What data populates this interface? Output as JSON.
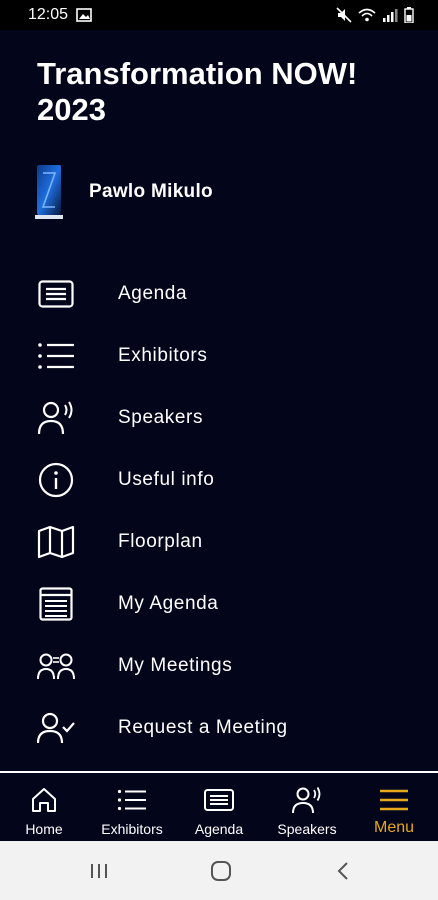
{
  "status": {
    "time": "12:05"
  },
  "header": {
    "title": "Transformation NOW! 2023"
  },
  "profile": {
    "name": "Pawlo Mikulo"
  },
  "menu": {
    "items": [
      {
        "label": "Agenda",
        "icon": "agenda-icon"
      },
      {
        "label": "Exhibitors",
        "icon": "list-icon"
      },
      {
        "label": "Speakers",
        "icon": "speaker-icon"
      },
      {
        "label": "Useful info",
        "icon": "info-icon"
      },
      {
        "label": "Floorplan",
        "icon": "map-icon"
      },
      {
        "label": "My Agenda",
        "icon": "calendar-list-icon"
      },
      {
        "label": "My Meetings",
        "icon": "meetings-icon"
      },
      {
        "label": "Request a Meeting",
        "icon": "user-check-icon"
      }
    ]
  },
  "bottom_nav": {
    "items": [
      {
        "label": "Home",
        "icon": "home-icon"
      },
      {
        "label": "Exhibitors",
        "icon": "list-icon"
      },
      {
        "label": "Agenda",
        "icon": "agenda-icon"
      },
      {
        "label": "Speakers",
        "icon": "speaker-icon"
      },
      {
        "label": "Menu",
        "icon": "hamburger-icon",
        "active": true
      }
    ]
  },
  "colors": {
    "background": "#03051a",
    "accent": "#e6a81c",
    "text": "#ffffff"
  }
}
